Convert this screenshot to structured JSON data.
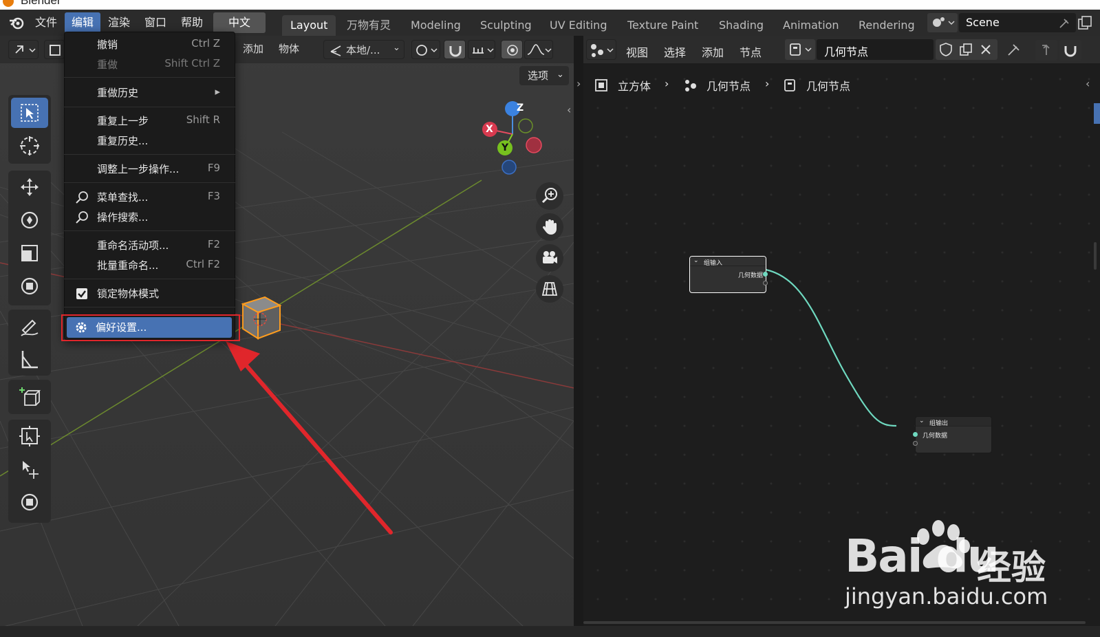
{
  "window": {
    "title": "Blender"
  },
  "topbar": {
    "menus": [
      "文件",
      "编辑",
      "渲染",
      "窗口",
      "帮助"
    ],
    "lang_button": "中文",
    "workspaces": [
      "Layout",
      "万物有灵",
      "Modeling",
      "Sculpting",
      "UV Editing",
      "Texture Paint",
      "Shading",
      "Animation",
      "Rendering"
    ],
    "scene": "Scene"
  },
  "viewport_header": {
    "add": "添加",
    "object": "物体",
    "transform_orientation": "本地/...",
    "options": "选项"
  },
  "edit_menu": {
    "items": [
      {
        "label": "撤销",
        "shortcut": "Ctrl Z"
      },
      {
        "label": "重做",
        "shortcut": "Shift Ctrl Z"
      },
      {
        "label": "重做历史",
        "shortcut": "▸"
      },
      {
        "label": "重复上一步",
        "shortcut": "Shift R"
      },
      {
        "label": "重复历史...",
        "shortcut": ""
      },
      {
        "label": "调整上一步操作...",
        "shortcut": "F9"
      },
      {
        "label": "菜单查找...",
        "shortcut": "F3"
      },
      {
        "label": "操作搜索...",
        "shortcut": ""
      },
      {
        "label": "重命名活动项...",
        "shortcut": "F2"
      },
      {
        "label": "批量重命名...",
        "shortcut": "Ctrl F2"
      },
      {
        "label": "锁定物体模式",
        "shortcut": ""
      },
      {
        "label": "偏好设置...",
        "shortcut": ""
      }
    ]
  },
  "gizmo": {
    "x": "X",
    "y": "Y",
    "z": "Z"
  },
  "node_editor": {
    "menus": [
      "视图",
      "选择",
      "添加",
      "节点"
    ],
    "node_tree": "几何节点",
    "breadcrumb": [
      "立方体",
      "几何节点",
      "几何节点"
    ],
    "group_input": {
      "title": "组输入",
      "socket": "几何数据"
    },
    "group_output": {
      "title": "组输出",
      "socket": "几何数据"
    }
  },
  "watermark": {
    "brand": "Bai du",
    "cn": "经验",
    "url": "jingyan.baidu.com"
  },
  "colors": {
    "accent": "#4772b3",
    "highlight_red": "#e0262b",
    "link": "#6fd9c0"
  }
}
